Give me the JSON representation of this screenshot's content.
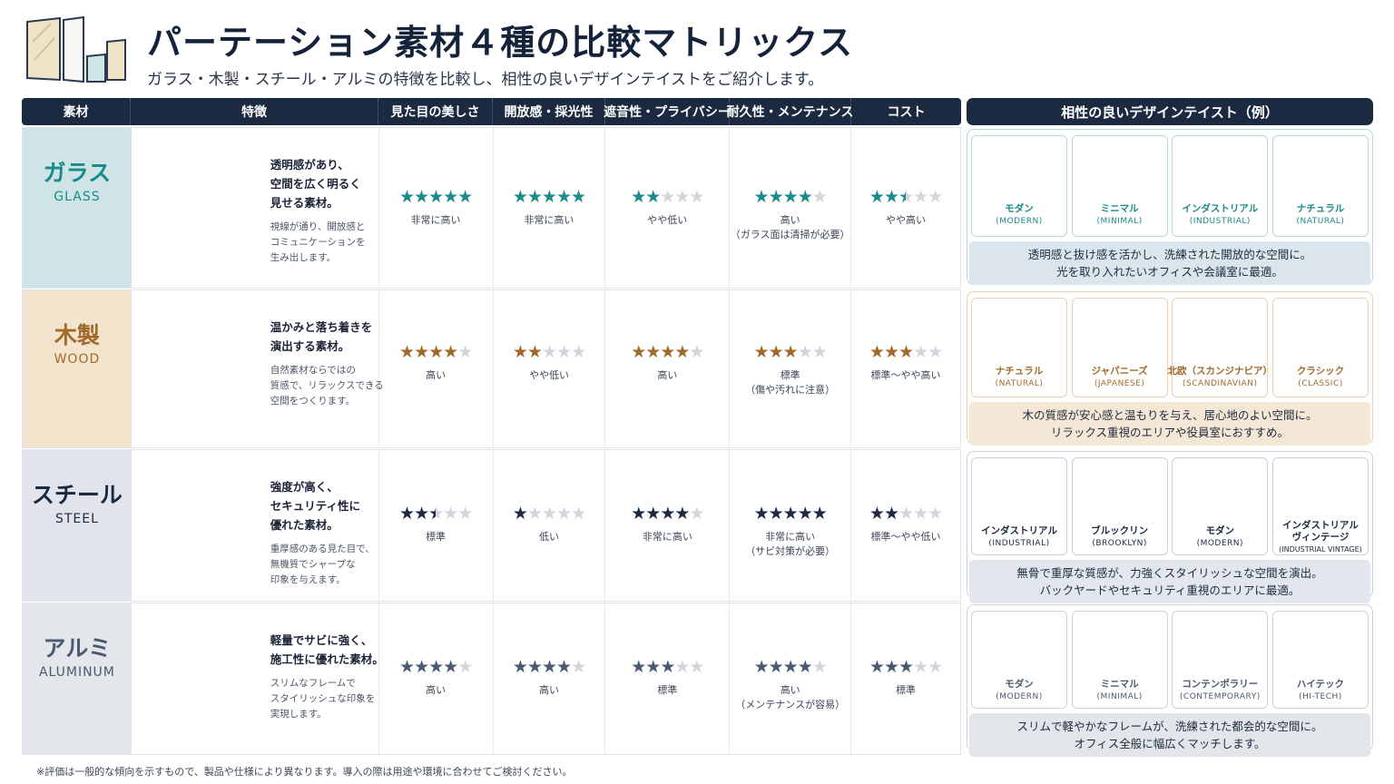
{
  "header": {
    "title": "パーテーション素材４種の比較マトリックス",
    "subtitle": "ガラス・木製・スチール・アルミの特徴を比較し、相性の良いデザインテイストをご紹介します。"
  },
  "columns": {
    "material": "素材",
    "features": "特徴",
    "appearance": "見た目の美しさ",
    "openness": "開放感・採光性",
    "privacy": "遮音性・プライバシー",
    "durability": "耐久性・メンテナンス",
    "cost": "コスト",
    "taste": "相性の良いデザインテイスト（例）"
  },
  "colors": {
    "glass": "#1a8a8a",
    "wood": "#a06a2a",
    "steel": "#1b2a41",
    "aluminum": "#4a5a70"
  },
  "materials": [
    {
      "name": "ガラス",
      "en": "GLASS",
      "icon": "glass-pane-icon",
      "color": "#1a8a8a",
      "desc_main": [
        "透明感があり、",
        "空間を広く明るく",
        "見せる素材。"
      ],
      "desc_sub": [
        "視線が通り、開放感と",
        "コミュニケーションを",
        "生み出します。"
      ],
      "ratings": [
        {
          "stars": 5,
          "label": "非常に高い",
          "note": ""
        },
        {
          "stars": 5,
          "label": "非常に高い",
          "note": ""
        },
        {
          "stars": 2,
          "label": "やや低い",
          "note": ""
        },
        {
          "stars": 4,
          "label": "高い",
          "note": "（ガラス面は清掃が必要）"
        },
        {
          "stars": 2.5,
          "label": "やや高い",
          "note": ""
        }
      ],
      "tastes": [
        {
          "jp": "モダン",
          "en": "(MODERN)",
          "icon": "office-building-icon"
        },
        {
          "jp": "ミニマル",
          "en": "(MINIMAL)",
          "icon": "table-chairs-icon"
        },
        {
          "jp": "インダストリアル",
          "en": "(INDUSTRIAL)",
          "icon": "pendant-lights-icon"
        },
        {
          "jp": "ナチュラル",
          "en": "(NATURAL)",
          "icon": "door-plant-icon"
        }
      ],
      "taste_desc": [
        "透明感と抜け感を活かし、洗練された開放的な空間に。",
        "光を取り入れたいオフィスや会議室に最適。"
      ]
    },
    {
      "name": "木製",
      "en": "WOOD",
      "icon": "wood-grain-icon",
      "color": "#a06a2a",
      "desc_main": [
        "温かみと落ち着きを",
        "演出する素材。"
      ],
      "desc_sub": [
        "自然素材ならではの",
        "質感で、リラックスできる",
        "空間をつくります。"
      ],
      "ratings": [
        {
          "stars": 4,
          "label": "高い",
          "note": ""
        },
        {
          "stars": 2,
          "label": "やや低い",
          "note": ""
        },
        {
          "stars": 4,
          "label": "高い",
          "note": ""
        },
        {
          "stars": 3,
          "label": "標準",
          "note": "（傷や汚れに注意）"
        },
        {
          "stars": 3,
          "label": "標準～やや高い",
          "note": ""
        }
      ],
      "tastes": [
        {
          "jp": "ナチュラル",
          "en": "(NATURAL)",
          "icon": "lounge-chair-lamp-icon"
        },
        {
          "jp": "ジャパニーズ",
          "en": "(JAPANESE)",
          "icon": "shoji-screen-icon"
        },
        {
          "jp": "北欧（スカンジナビア）",
          "en": "(SCANDINAVIAN)",
          "icon": "sofa-plant-icon"
        },
        {
          "jp": "クラシック",
          "en": "(CLASSIC)",
          "icon": "bookshelf-icon"
        }
      ],
      "taste_desc": [
        "木の質感が安心感と温もりを与え、居心地のよい空間に。",
        "リラックス重視のエリアや役員室におすすめ。"
      ]
    },
    {
      "name": "スチール",
      "en": "STEEL",
      "icon": "perforated-panel-icon",
      "color": "#1b2a41",
      "desc_main": [
        "強度が高く、",
        "セキュリティ性に",
        "優れた素材。"
      ],
      "desc_sub": [
        "重厚感のある見た目で、",
        "無機質でシャープな",
        "印象を与えます。"
      ],
      "ratings": [
        {
          "stars": 2.5,
          "label": "標準",
          "note": ""
        },
        {
          "stars": 1,
          "label": "低い",
          "note": ""
        },
        {
          "stars": 4,
          "label": "非常に高い",
          "note": ""
        },
        {
          "stars": 5,
          "label": "非常に高い",
          "note": "（サビ対策が必要）"
        },
        {
          "stars": 2,
          "label": "標準～やや低い",
          "note": ""
        }
      ],
      "tastes": [
        {
          "jp": "インダストリアル",
          "en": "(INDUSTRIAL)",
          "icon": "factory-icon"
        },
        {
          "jp": "ブルックリン",
          "en": "(BROOKLYN)",
          "icon": "lamp-brick-icon"
        },
        {
          "jp": "モダン",
          "en": "(MODERN)",
          "icon": "chairs-frame-icon"
        },
        {
          "jp": "インダストリアル\nヴィンテージ",
          "en": "(INDUSTRIAL VINTAGE)",
          "icon": "locker-shelf-icon"
        }
      ],
      "taste_desc": [
        "無骨で重厚な質感が、力強くスタイリッシュな空間を演出。",
        "バックヤードやセキュリティ重視のエリアに最適。"
      ]
    },
    {
      "name": "アルミ",
      "en": "ALUMINUM",
      "icon": "frame-icon",
      "color": "#4a5a70",
      "desc_main": [
        "軽量でサビに強く、",
        "施工性に優れた素材。"
      ],
      "desc_sub": [
        "スリムなフレームで",
        "スタイリッシュな印象を",
        "実現します。"
      ],
      "ratings": [
        {
          "stars": 4,
          "label": "高い",
          "note": ""
        },
        {
          "stars": 4,
          "label": "高い",
          "note": ""
        },
        {
          "stars": 3,
          "label": "標準",
          "note": ""
        },
        {
          "stars": 4,
          "label": "高い",
          "note": "（メンテナンスが容易）"
        },
        {
          "stars": 3,
          "label": "標準",
          "note": ""
        }
      ],
      "tastes": [
        {
          "jp": "モダン",
          "en": "(MODERN)",
          "icon": "office-building-icon"
        },
        {
          "jp": "ミニマル",
          "en": "(MINIMAL)",
          "icon": "desk-icon"
        },
        {
          "jp": "コンテンポラリー",
          "en": "(CONTEMPORARY)",
          "icon": "pendant-table-icon"
        },
        {
          "jp": "ハイテック",
          "en": "(HI-TECH)",
          "icon": "devices-icon"
        }
      ],
      "taste_desc": [
        "スリムで軽やかなフレームが、洗練された都会的な空間に。",
        "オフィス全般に幅広くマッチします。"
      ]
    }
  ],
  "footnote": "※評価は一般的な傾向を示すもので、製品や仕様により異なります。導入の際は用途や環境に合わせてご検討ください。"
}
